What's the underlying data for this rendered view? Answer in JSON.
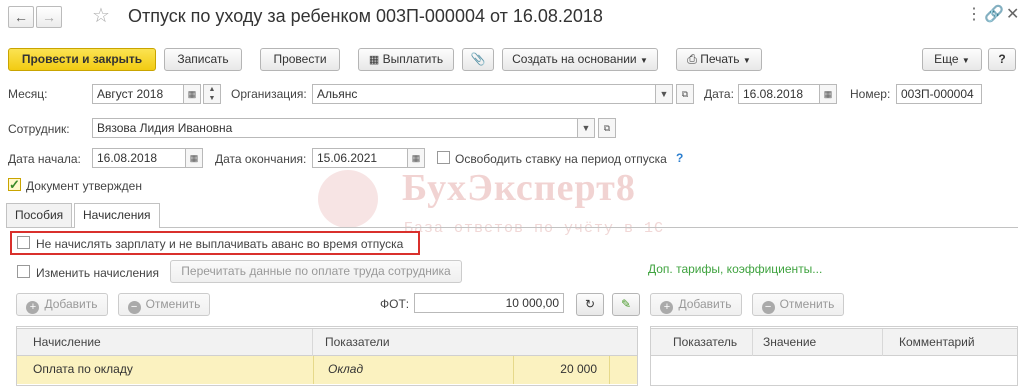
{
  "window": {
    "title": "Отпуск по уходу за ребенком 003П-000004 от 16.08.2018",
    "back_icon": "arrow-left-icon",
    "forward_icon": "arrow-right-icon",
    "star_icon": "star-icon"
  },
  "toolbar": {
    "post_close": "Провести и закрыть",
    "save": "Записать",
    "post": "Провести",
    "pay": "Выплатить",
    "create_based": "Создать на основании",
    "print": "Печать",
    "more": "Еще",
    "help": "?"
  },
  "form": {
    "month_label": "Месяц:",
    "month_value": "Август 2018",
    "org_label": "Организация:",
    "org_value": "Альянс",
    "date_label": "Дата:",
    "date_value": "16.08.2018",
    "number_label": "Номер:",
    "number_value": "003П-000004",
    "employee_label": "Сотрудник:",
    "employee_value": "Вязова Лидия Ивановна",
    "start_label": "Дата начала:",
    "start_value": "16.08.2018",
    "end_label": "Дата окончания:",
    "end_value": "15.06.2021",
    "release_rate_label": "Освободить ставку на период отпуска",
    "help_mark": "?",
    "approved_label": "Документ утвержден"
  },
  "tabs": [
    {
      "label": "Пособия"
    },
    {
      "label": "Начисления"
    }
  ],
  "accruals": {
    "no_salary_label": "Не начислять зарплату и не выплачивать аванс во время отпуска",
    "change_accruals_label": "Изменить начисления",
    "reread_button": "Перечитать данные по оплате труда сотрудника",
    "extra_rates_link": "Доп. тарифы, коэффициенты...",
    "add_button": "Добавить",
    "cancel_button": "Отменить",
    "fot_label": "ФОТ:",
    "fot_value": "10 000,00",
    "right_add_button": "Добавить",
    "right_cancel_button": "Отменить"
  },
  "left_table": {
    "headers": [
      "Начисление",
      "Показатели"
    ],
    "rows": [
      {
        "accrual": "Оплата по окладу",
        "indicator": "Оклад",
        "amount": "20 000"
      }
    ]
  },
  "right_table": {
    "headers": [
      "Показатель",
      "Значение",
      "Комментарий"
    ]
  },
  "watermark": {
    "brand": "БухЭксперт8",
    "tagline": "База ответов по учёту в 1С"
  },
  "colors": {
    "primary_button": "#f2cb12",
    "highlight_border": "#d9302c",
    "row_highlight": "#fbf2c0",
    "link_green": "#3fa33f",
    "help_blue": "#2c7fd0"
  }
}
